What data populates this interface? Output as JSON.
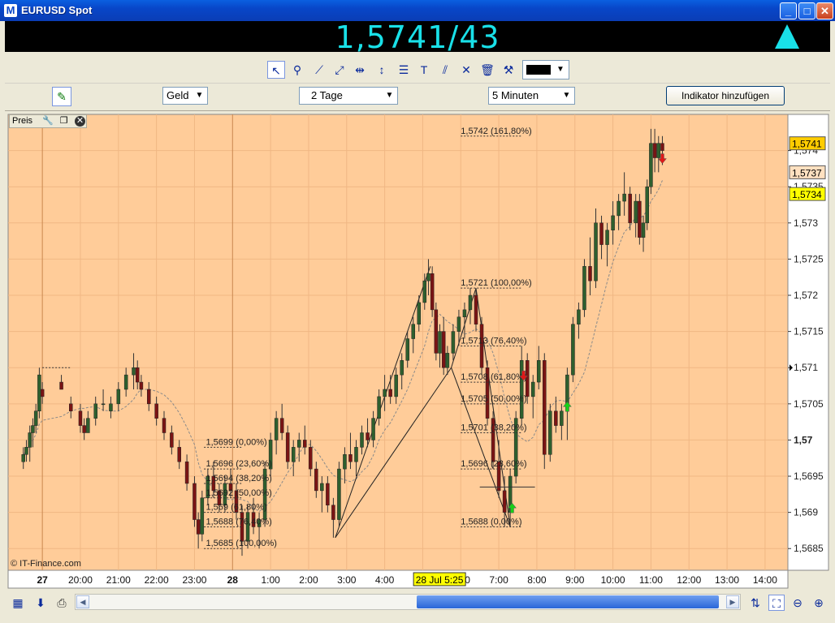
{
  "window": {
    "title": "EURUSD Spot",
    "minimize": "_",
    "maximize": "□",
    "close": "✕"
  },
  "quote": {
    "price": "1,5741/43",
    "direction": "up"
  },
  "toolbar": {
    "tools": [
      "pointer-icon",
      "zoom-icon",
      "trendline-icon",
      "ray-icon",
      "horizontal-line-icon",
      "vertical-line-icon",
      "fibonacci-icon",
      "text-icon",
      "channel-icon",
      "cross-icon",
      "trash-icon",
      "properties-icon"
    ],
    "color": "#000000"
  },
  "options": {
    "price_type": "Geld",
    "period": "2 Tage",
    "interval": "5 Minuten",
    "add_indicator": "Indikator hinzufügen"
  },
  "panel": {
    "label": "Preis"
  },
  "credit": "© IT-Finance.com",
  "colors": {
    "background": "#ffcc99",
    "up_candle": "#2e5f2e",
    "down_candle": "#7a1414",
    "accent": "#19e0e8"
  },
  "chart_data": {
    "type": "candlestick",
    "symbol": "EURUSD",
    "ylim": [
      1.5682,
      1.5745
    ],
    "y_ticks": [
      "1,5685",
      "1,569",
      "1,5695",
      "1,57",
      "1,5705",
      "1,571",
      "1,5715",
      "1,572",
      "1,5725",
      "1,573",
      "1,5735",
      "1,574"
    ],
    "x_ticks": [
      "27",
      "20:00",
      "21:00",
      "22:00",
      "23:00",
      "28",
      "1:00",
      "2:00",
      "3:00",
      "4:00",
      "5:00",
      "6:00",
      "7:00",
      "8:00",
      "9:00",
      "10:00",
      "11:00",
      "12:00",
      "13:00",
      "14:00"
    ],
    "cursor_time": "28 Jul 5:25",
    "price_labels": [
      {
        "text": "1,5741",
        "value": 1.5741,
        "color": "#ffcc00"
      },
      {
        "text": "1,5737",
        "value": 1.5737,
        "color": "#ffe0c0"
      },
      {
        "text": "1,5734",
        "value": 1.5734,
        "color": "#ffff00"
      }
    ],
    "fib_levels_1": [
      {
        "label": "1,5699 (0,00%)",
        "value": 1.5699
      },
      {
        "label": "1,5696 (23,60%)",
        "value": 1.5696
      },
      {
        "label": "1,5694 (38,20%)",
        "value": 1.5694
      },
      {
        "label": "1,5692 (50,00%)",
        "value": 1.5692
      },
      {
        "label": "1,569 (61,80%)",
        "value": 1.569
      },
      {
        "label": "1,5688 (76,40%)",
        "value": 1.5688
      },
      {
        "label": "1,5685 (100,00%)",
        "value": 1.5685
      }
    ],
    "fib_levels_2": [
      {
        "label": "1,5742 (161,80%)",
        "value": 1.5742
      },
      {
        "label": "1,5721 (100,00%)",
        "value": 1.5721
      },
      {
        "label": "1,5713 (76,40%)",
        "value": 1.5713
      },
      {
        "label": "1,5708 (61,80%)",
        "value": 1.5708
      },
      {
        "label": "1,5705 (50,00%)",
        "value": 1.5705
      },
      {
        "label": "1,5701 (38,20%)",
        "value": 1.5701
      },
      {
        "label": "1,5696 (23,60%)",
        "value": 1.5696
      },
      {
        "label": "1,5688 (0,00%)",
        "value": 1.5688
      }
    ],
    "trend_lines": [
      {
        "x0": 2.7,
        "y0": 1.56865,
        "x1": 5.2,
        "y1": 1.5724
      },
      {
        "x0": 2.7,
        "y0": 1.56865,
        "x1": 5.75,
        "y1": 1.571
      },
      {
        "x0": 5.75,
        "y0": 1.571,
        "x1": 6.4,
        "y1": 1.5721
      },
      {
        "x0": 5.75,
        "y0": 1.571,
        "x1": 7.3,
        "y1": 1.5688
      },
      {
        "x0": 6.4,
        "y0": 1.5721,
        "x1": 7.3,
        "y1": 1.5688
      }
    ],
    "signals": [
      {
        "t": 7.35,
        "price": 1.56905,
        "dir": "up"
      },
      {
        "t": 7.65,
        "price": 1.5709,
        "dir": "down"
      },
      {
        "t": 8.8,
        "price": 1.57045,
        "dir": "up"
      },
      {
        "t": 11.3,
        "price": 1.5739,
        "dir": "down"
      }
    ],
    "candles": [
      [
        -5.5,
        1.5697,
        1.5699,
        1.5696,
        1.5698
      ],
      [
        -5.42,
        1.5698,
        1.57,
        1.5697,
        1.5699
      ],
      [
        -5.33,
        1.5699,
        1.5702,
        1.5697,
        1.5701
      ],
      [
        -5.25,
        1.5701,
        1.5703,
        1.5699,
        1.5702
      ],
      [
        -5.17,
        1.5702,
        1.5705,
        1.5701,
        1.5704
      ],
      [
        -5.08,
        1.5704,
        1.571,
        1.5703,
        1.5709
      ],
      [
        -5.0,
        1.5707,
        1.5708,
        1.5705,
        1.5706
      ],
      [
        -4.5,
        1.5708,
        1.5709,
        1.5707,
        1.5707
      ],
      [
        -4.25,
        1.5705,
        1.5706,
        1.5703,
        1.5704
      ],
      [
        -4.0,
        1.5704,
        1.5705,
        1.5701,
        1.5702
      ],
      [
        -3.9,
        1.5702,
        1.5703,
        1.57,
        1.5701
      ],
      [
        -3.8,
        1.5701,
        1.5704,
        1.5701,
        1.5703
      ],
      [
        -3.6,
        1.5703,
        1.5706,
        1.5702,
        1.5705
      ],
      [
        -3.4,
        1.5705,
        1.5707,
        1.5704,
        1.5705
      ],
      [
        -3.2,
        1.5704,
        1.5706,
        1.5703,
        1.5705
      ],
      [
        -3.0,
        1.5705,
        1.5708,
        1.5704,
        1.5707
      ],
      [
        -2.8,
        1.5707,
        1.571,
        1.5706,
        1.5709
      ],
      [
        -2.6,
        1.5709,
        1.5712,
        1.5707,
        1.571
      ],
      [
        -2.5,
        1.571,
        1.5711,
        1.5707,
        1.5708
      ],
      [
        -2.4,
        1.5708,
        1.5709,
        1.5706,
        1.5707
      ],
      [
        -2.2,
        1.5707,
        1.5708,
        1.5704,
        1.5705
      ],
      [
        -2.0,
        1.5705,
        1.5706,
        1.5702,
        1.5703
      ],
      [
        -1.8,
        1.5703,
        1.5704,
        1.57,
        1.5701
      ],
      [
        -1.6,
        1.5701,
        1.5702,
        1.5698,
        1.5699
      ],
      [
        -1.4,
        1.5699,
        1.57,
        1.5696,
        1.5697
      ],
      [
        -1.2,
        1.5697,
        1.5698,
        1.5693,
        1.5694
      ],
      [
        -1.0,
        1.5694,
        1.5695,
        1.5688,
        1.5689
      ],
      [
        -0.9,
        1.5689,
        1.569,
        1.5685,
        1.5687
      ],
      [
        -0.8,
        1.5687,
        1.5693,
        1.5686,
        1.5692
      ],
      [
        -0.65,
        1.5692,
        1.5696,
        1.5691,
        1.5695
      ],
      [
        -0.5,
        1.5695,
        1.5697,
        1.5692,
        1.5693
      ],
      [
        -0.35,
        1.5693,
        1.5694,
        1.569,
        1.5691
      ],
      [
        -0.2,
        1.5691,
        1.5695,
        1.569,
        1.5694
      ],
      [
        -0.05,
        1.5694,
        1.5696,
        1.5692,
        1.5693
      ],
      [
        0.1,
        1.5693,
        1.5694,
        1.5689,
        1.569
      ],
      [
        0.25,
        1.569,
        1.5691,
        1.5684,
        1.5686
      ],
      [
        0.4,
        1.5686,
        1.5691,
        1.5685,
        1.569
      ],
      [
        0.55,
        1.569,
        1.5692,
        1.5687,
        1.5688
      ],
      [
        0.7,
        1.5688,
        1.569,
        1.5685,
        1.5689
      ],
      [
        0.85,
        1.5689,
        1.5697,
        1.5688,
        1.5696
      ],
      [
        1.0,
        1.5696,
        1.5701,
        1.5695,
        1.57
      ],
      [
        1.15,
        1.57,
        1.5704,
        1.5698,
        1.5703
      ],
      [
        1.3,
        1.5703,
        1.5705,
        1.57,
        1.5701
      ],
      [
        1.45,
        1.5701,
        1.5702,
        1.5696,
        1.5697
      ],
      [
        1.6,
        1.5697,
        1.57,
        1.5695,
        1.5699
      ],
      [
        1.75,
        1.5699,
        1.5701,
        1.5697,
        1.57
      ],
      [
        1.9,
        1.57,
        1.5702,
        1.5698,
        1.5699
      ],
      [
        2.05,
        1.5699,
        1.57,
        1.5695,
        1.5696
      ],
      [
        2.2,
        1.5696,
        1.5697,
        1.5692,
        1.5693
      ],
      [
        2.35,
        1.5693,
        1.5695,
        1.569,
        1.5694
      ],
      [
        2.5,
        1.5694,
        1.5695,
        1.569,
        1.5691
      ],
      [
        2.65,
        1.5691,
        1.5692,
        1.56865,
        1.5689
      ],
      [
        2.8,
        1.5689,
        1.5697,
        1.5688,
        1.5696
      ],
      [
        2.95,
        1.5696,
        1.5699,
        1.5694,
        1.5698
      ],
      [
        3.1,
        1.5698,
        1.5701,
        1.5696,
        1.5697
      ],
      [
        3.25,
        1.5697,
        1.57,
        1.5695,
        1.5699
      ],
      [
        3.4,
        1.5699,
        1.5702,
        1.5698,
        1.5701
      ],
      [
        3.55,
        1.5701,
        1.5703,
        1.5699,
        1.57
      ],
      [
        3.7,
        1.57,
        1.5704,
        1.5699,
        1.5703
      ],
      [
        3.85,
        1.5703,
        1.5707,
        1.5702,
        1.5706
      ],
      [
        4.0,
        1.5706,
        1.5709,
        1.5704,
        1.5707
      ],
      [
        4.15,
        1.5707,
        1.5709,
        1.5705,
        1.5706
      ],
      [
        4.3,
        1.5706,
        1.571,
        1.5705,
        1.5709
      ],
      [
        4.45,
        1.5709,
        1.5712,
        1.5707,
        1.5711
      ],
      [
        4.6,
        1.5711,
        1.5715,
        1.571,
        1.5714
      ],
      [
        4.75,
        1.5714,
        1.5717,
        1.5712,
        1.5716
      ],
      [
        4.9,
        1.5716,
        1.572,
        1.5715,
        1.5719
      ],
      [
        5.05,
        1.5719,
        1.5723,
        1.5718,
        1.5722
      ],
      [
        5.15,
        1.5722,
        1.5725,
        1.572,
        1.5723
      ],
      [
        5.25,
        1.5723,
        1.5724,
        1.5717,
        1.5718
      ],
      [
        5.35,
        1.5718,
        1.5719,
        1.5711,
        1.5712
      ],
      [
        5.45,
        1.5712,
        1.5716,
        1.571,
        1.5715
      ],
      [
        5.55,
        1.5715,
        1.5717,
        1.5709,
        1.571
      ],
      [
        5.65,
        1.571,
        1.5713,
        1.5709,
        1.5712
      ],
      [
        5.8,
        1.5712,
        1.5716,
        1.5711,
        1.5715
      ],
      [
        5.95,
        1.5715,
        1.5718,
        1.5713,
        1.5717
      ],
      [
        6.1,
        1.5717,
        1.5719,
        1.5714,
        1.5718
      ],
      [
        6.25,
        1.5718,
        1.5721,
        1.5716,
        1.572
      ],
      [
        6.4,
        1.572,
        1.5721,
        1.5715,
        1.5716
      ],
      [
        6.55,
        1.5716,
        1.5717,
        1.5709,
        1.571
      ],
      [
        6.7,
        1.571,
        1.5711,
        1.5702,
        1.5703
      ],
      [
        6.85,
        1.5703,
        1.5704,
        1.5696,
        1.5697
      ],
      [
        7.0,
        1.5697,
        1.57,
        1.5692,
        1.5693
      ],
      [
        7.15,
        1.5693,
        1.5695,
        1.5688,
        1.569
      ],
      [
        7.3,
        1.569,
        1.5696,
        1.5688,
        1.5695
      ],
      [
        7.45,
        1.5695,
        1.5704,
        1.5694,
        1.5703
      ],
      [
        7.6,
        1.5703,
        1.5713,
        1.5702,
        1.5711
      ],
      [
        7.75,
        1.5711,
        1.5712,
        1.5705,
        1.5706
      ],
      [
        7.9,
        1.5706,
        1.5709,
        1.5703,
        1.5708
      ],
      [
        8.05,
        1.5708,
        1.5713,
        1.5707,
        1.5711
      ],
      [
        8.2,
        1.5711,
        1.5712,
        1.5696,
        1.5698
      ],
      [
        8.35,
        1.5698,
        1.5705,
        1.5697,
        1.5704
      ],
      [
        8.5,
        1.5704,
        1.5706,
        1.5701,
        1.5702
      ],
      [
        8.65,
        1.5702,
        1.5705,
        1.57,
        1.5704
      ],
      [
        8.8,
        1.5704,
        1.571,
        1.57,
        1.5709
      ],
      [
        8.95,
        1.5709,
        1.5717,
        1.5708,
        1.5716
      ],
      [
        9.1,
        1.5716,
        1.5719,
        1.5714,
        1.5718
      ],
      [
        9.25,
        1.5718,
        1.5725,
        1.5717,
        1.5724
      ],
      [
        9.4,
        1.5724,
        1.5728,
        1.572,
        1.5722
      ],
      [
        9.55,
        1.5722,
        1.5732,
        1.5721,
        1.573
      ],
      [
        9.7,
        1.573,
        1.5731,
        1.5725,
        1.5727
      ],
      [
        9.85,
        1.5727,
        1.573,
        1.5724,
        1.5729
      ],
      [
        10.0,
        1.5729,
        1.5733,
        1.5727,
        1.5731
      ],
      [
        10.15,
        1.5731,
        1.5734,
        1.5729,
        1.5733
      ],
      [
        10.3,
        1.5733,
        1.5737,
        1.5731,
        1.5734
      ],
      [
        10.45,
        1.5734,
        1.5735,
        1.5729,
        1.573
      ],
      [
        10.6,
        1.573,
        1.5734,
        1.5728,
        1.5733
      ],
      [
        10.7,
        1.5733,
        1.5734,
        1.5727,
        1.5728
      ],
      [
        10.8,
        1.5728,
        1.5731,
        1.5726,
        1.573
      ],
      [
        10.9,
        1.573,
        1.5736,
        1.5729,
        1.5735
      ],
      [
        11.0,
        1.5735,
        1.5743,
        1.5734,
        1.5741
      ],
      [
        11.1,
        1.5741,
        1.5743,
        1.5737,
        1.5739
      ],
      [
        11.2,
        1.5739,
        1.5742,
        1.5737,
        1.5741
      ],
      [
        11.3,
        1.5741,
        1.5742,
        1.5738,
        1.574
      ]
    ]
  }
}
